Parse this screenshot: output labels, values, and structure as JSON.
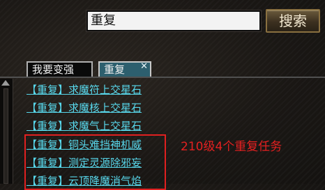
{
  "search": {
    "value": "重复",
    "button_label": "搜索"
  },
  "tabs": [
    {
      "label": "我要变强"
    },
    {
      "label": "重复",
      "close_icon": "✕"
    }
  ],
  "quests": [
    {
      "label": "【重复】求魔符上交星石"
    },
    {
      "label": "【重复】求魔核上交星石"
    },
    {
      "label": "【重复】求魔气上交星石"
    },
    {
      "label": "【重复】铜头难挡神机威"
    },
    {
      "label": "【重复】测定灵源除邪妄"
    },
    {
      "label": "【重复】云顶降魔消气焰"
    }
  ],
  "annotation": {
    "text": "210级4个重复任务",
    "color": "#e42020"
  },
  "colors": {
    "quest_link": "#58d8ec",
    "highlight_border": "#e02020",
    "active_tab": "#2d5f6e"
  },
  "icons": {
    "scroll_up": "triangle-up-icon",
    "tab_close": "close-icon"
  }
}
